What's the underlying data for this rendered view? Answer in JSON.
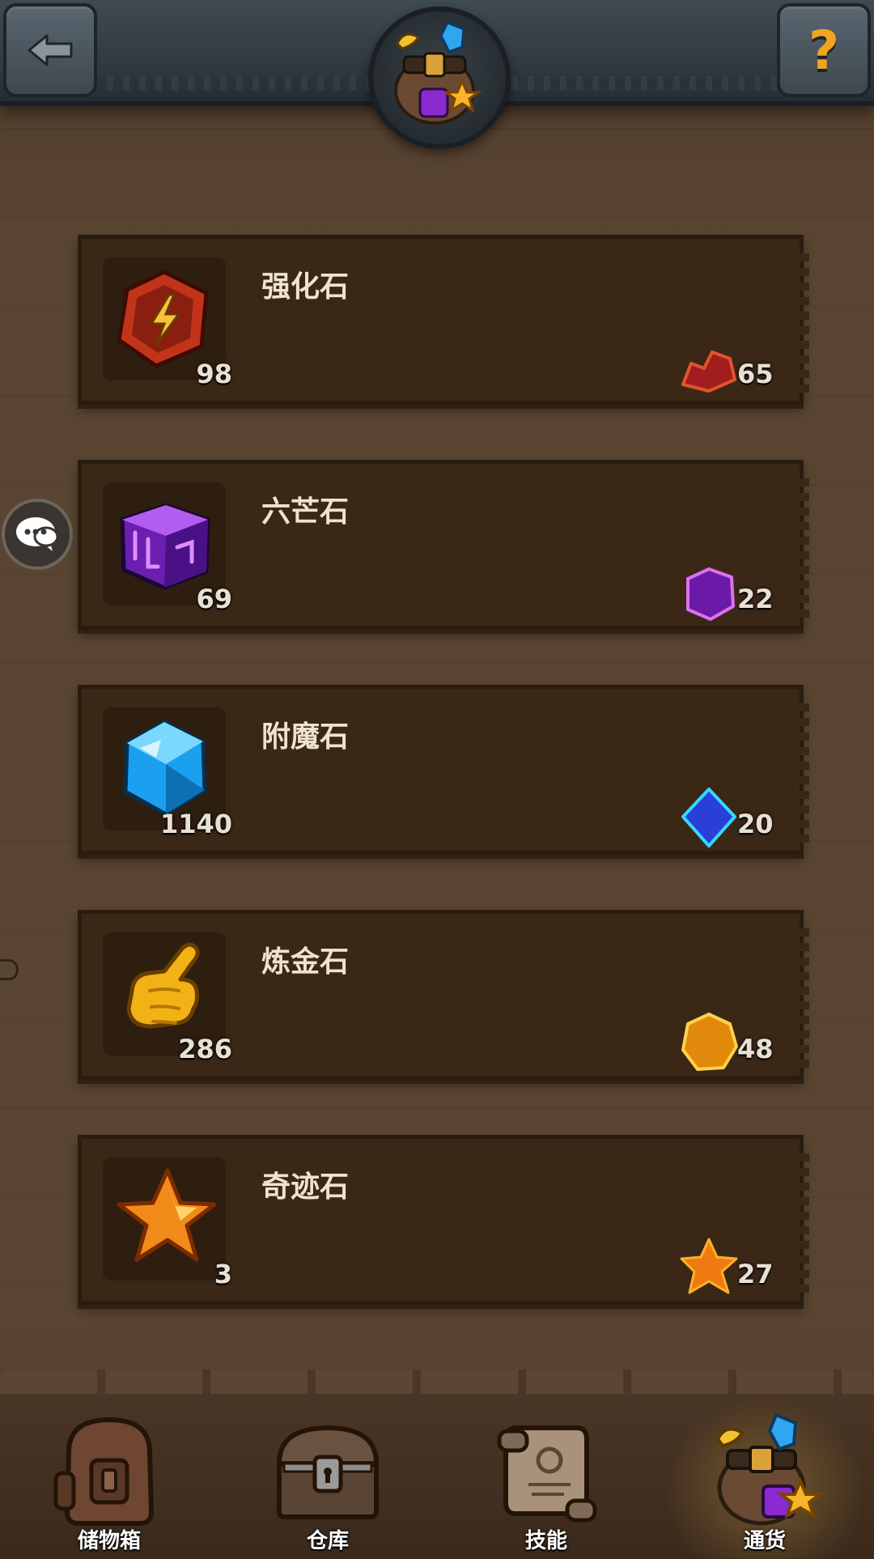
{
  "header": {
    "back_icon": "back-arrow-icon",
    "help_label": "?",
    "emblem_icon": "treasure-bag-icon"
  },
  "chat": {
    "icon": "chat-bubble-icon"
  },
  "items": [
    {
      "name": "强化石",
      "count": "98",
      "icon": "enhance-stone-icon",
      "fragment_icon": "red-fragment-icon",
      "fragment_count": "65",
      "color": "#d23a1e"
    },
    {
      "name": "六芒石",
      "count": "69",
      "icon": "purple-cube-icon",
      "fragment_icon": "purple-fragment-icon",
      "fragment_count": "22",
      "color": "#9b2fd6"
    },
    {
      "name": "附魔石",
      "count": "1140",
      "icon": "blue-gem-icon",
      "fragment_icon": "blue-fragment-icon",
      "fragment_count": "20",
      "color": "#22a8e8"
    },
    {
      "name": "炼金石",
      "count": "286",
      "icon": "golden-hand-icon",
      "fragment_icon": "gold-fragment-icon",
      "fragment_count": "48",
      "color": "#f0b116"
    },
    {
      "name": "奇迹石",
      "count": "3",
      "icon": "orange-star-icon",
      "fragment_icon": "star-fragment-icon",
      "fragment_count": "27",
      "color": "#f08a1a"
    }
  ],
  "bottom_nav": [
    {
      "label": "储物箱",
      "icon": "backpack-icon",
      "active": false
    },
    {
      "label": "仓库",
      "icon": "chest-icon",
      "active": false
    },
    {
      "label": "技能",
      "icon": "scroll-icon",
      "active": false
    },
    {
      "label": "通货",
      "icon": "treasure-bag-icon",
      "active": true
    }
  ]
}
